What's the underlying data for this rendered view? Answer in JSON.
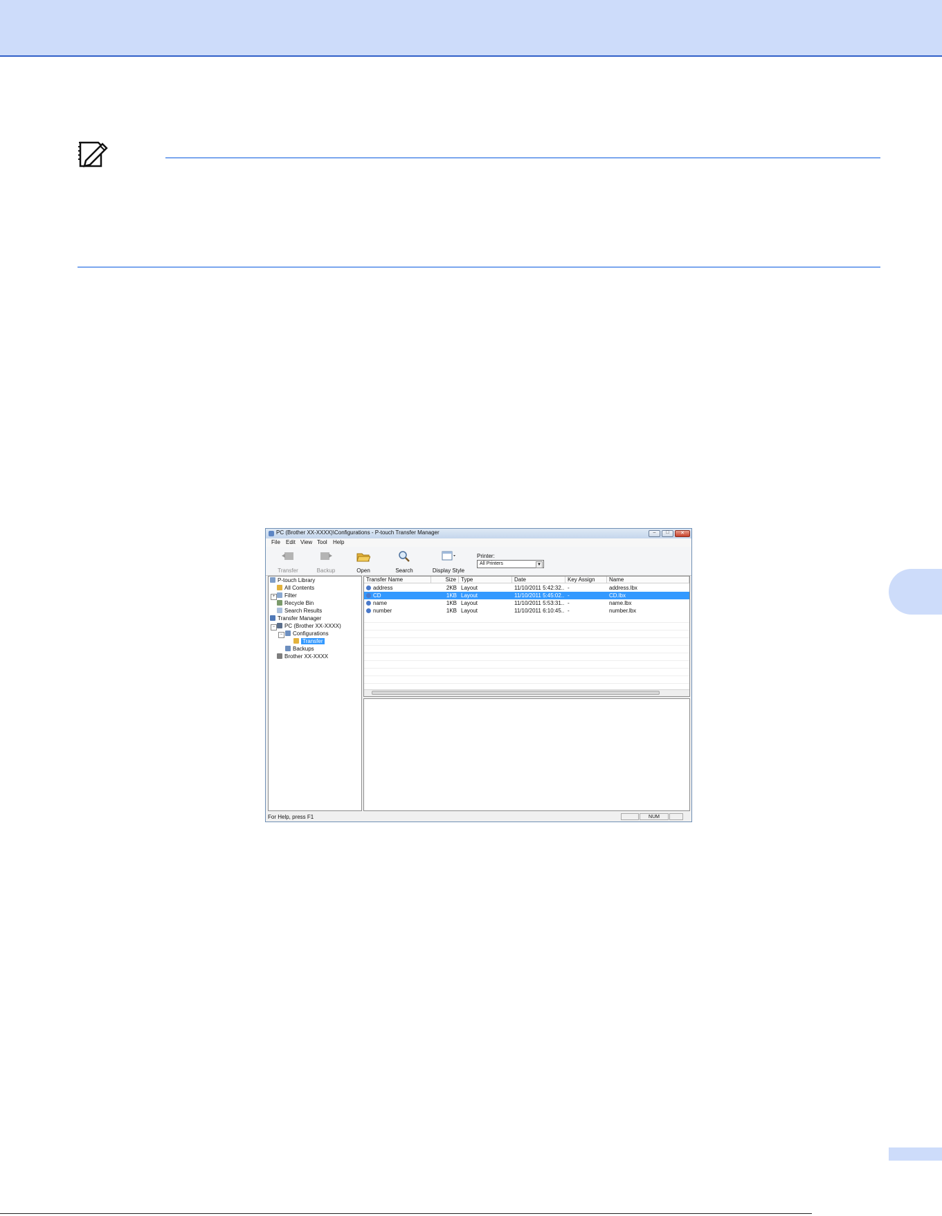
{
  "page": {
    "colors": {
      "band": "#cddcfa",
      "rule": "#7aa6ee",
      "dark_rule": "#2f5fc8"
    }
  },
  "note": {
    "icon": "note-pencil-icon"
  },
  "window": {
    "title": "PC (Brother XX-XXXX)\\Configurations - P-touch Transfer Manager",
    "buttons": {
      "minimize": "–",
      "maximize": "□",
      "close": "✕"
    },
    "menu": [
      "File",
      "Edit",
      "View",
      "Tool",
      "Help"
    ],
    "toolbar": {
      "transfer": "Transfer",
      "backup": "Backup",
      "open": "Open",
      "search": "Search",
      "display_style": "Display Style",
      "printer_label": "Printer:",
      "printer_value": "All Printers"
    },
    "tree": [
      {
        "label": "P-touch Library",
        "icon": "library-icon"
      },
      {
        "label": "All Contents",
        "icon": "folder-icon"
      },
      {
        "label": "Filter",
        "icon": "filter-icon"
      },
      {
        "label": "Recycle Bin",
        "icon": "recycle-bin-icon"
      },
      {
        "label": "Search Results",
        "icon": "search-icon"
      },
      {
        "label": "Transfer Manager",
        "icon": "transfer-icon"
      },
      {
        "label": "PC (Brother XX-XXXX)",
        "icon": "computer-icon"
      },
      {
        "label": "Configurations",
        "icon": "configurations-icon"
      },
      {
        "label": "Transfer",
        "icon": "folder-icon"
      },
      {
        "label": "Backups",
        "icon": "backups-icon"
      },
      {
        "label": "Brother XX-XXXX",
        "icon": "printer-icon"
      }
    ],
    "columns": [
      "Transfer Name",
      "Size",
      "Type",
      "Date",
      "Key Assign",
      "Name"
    ],
    "rows": [
      {
        "transfer_name": "address",
        "size": "2KB",
        "type": "Layout",
        "date": "11/10/2011 5:42:32...",
        "key_assign": "-",
        "name": "address.lbx"
      },
      {
        "transfer_name": "CD",
        "size": "1KB",
        "type": "Layout",
        "date": "11/10/2011 5:45:02...",
        "key_assign": "-",
        "name": "CD.lbx"
      },
      {
        "transfer_name": "name",
        "size": "1KB",
        "type": "Layout",
        "date": "11/10/2011 5:53:31...",
        "key_assign": "-",
        "name": "name.lbx"
      },
      {
        "transfer_name": "number",
        "size": "1KB",
        "type": "Layout",
        "date": "11/10/2011 6:10:45...",
        "key_assign": "-",
        "name": "number.lbx"
      }
    ],
    "status": {
      "help": "For Help, press F1",
      "num": "NUM"
    }
  }
}
